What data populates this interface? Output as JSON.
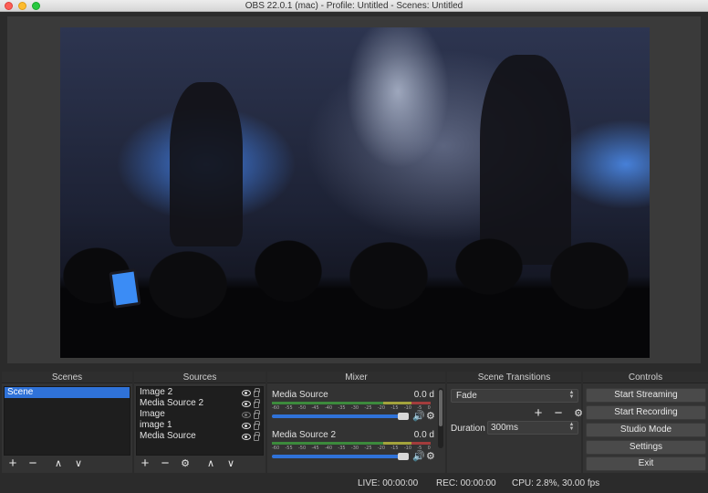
{
  "window": {
    "title": "OBS 22.0.1 (mac) - Profile: Untitled - Scenes: Untitled"
  },
  "docks": {
    "scenes": {
      "title": "Scenes",
      "items": [
        "Scene"
      ],
      "selected": "Scene"
    },
    "sources": {
      "title": "Sources",
      "items": [
        {
          "label": "Image 2",
          "visible": true
        },
        {
          "label": "Media Source 2",
          "visible": true
        },
        {
          "label": "Image",
          "visible": false
        },
        {
          "label": "image 1",
          "visible": true
        },
        {
          "label": "Media Source",
          "visible": true
        }
      ]
    },
    "mixer": {
      "title": "Mixer",
      "tracks": [
        {
          "name": "Media Source",
          "db": "0.0 d"
        },
        {
          "name": "Media Source 2",
          "db": "0.0 d"
        }
      ],
      "ticks": [
        "-60",
        "-55",
        "-50",
        "-45",
        "-40",
        "-35",
        "-30",
        "-25",
        "-20",
        "-15",
        "-10",
        "-5",
        "0"
      ]
    },
    "transitions": {
      "title": "Scene Transitions",
      "selected": "Fade",
      "duration_label": "Duration",
      "duration_value": "300ms"
    },
    "controls": {
      "title": "Controls",
      "buttons": [
        "Start Streaming",
        "Start Recording",
        "Studio Mode",
        "Settings",
        "Exit"
      ]
    }
  },
  "status": {
    "live": "LIVE: 00:00:00",
    "rec": "REC: 00:00:00",
    "cpu": "CPU: 2.8%, 30.00 fps"
  },
  "toolbar_glyphs": {
    "add": "+",
    "remove": "−",
    "up": "∧",
    "down": "∨",
    "gear": "⚙",
    "volume": "🔊"
  },
  "colors": {
    "accent": "#2f72d8",
    "panel": "#333333",
    "list_bg": "#1e1e1e"
  }
}
